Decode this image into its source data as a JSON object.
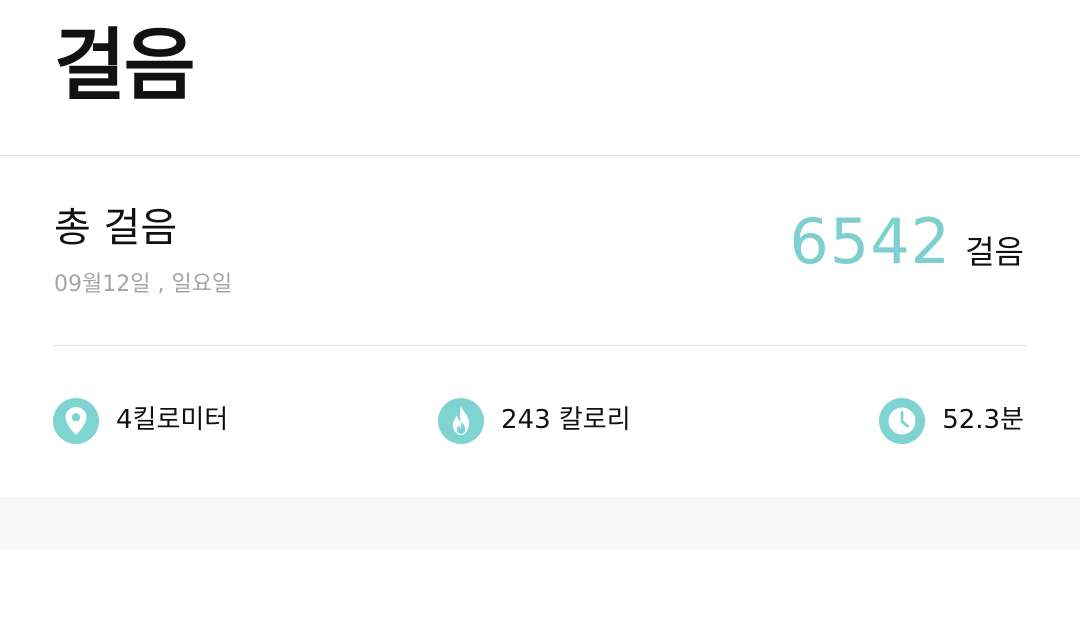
{
  "header": {
    "title": "걸음"
  },
  "summary": {
    "label": "총 걸음",
    "date": "09월12일 , 일요일",
    "steps": "6542",
    "steps_unit": "걸음"
  },
  "stats": {
    "distance": {
      "icon": "location-pin-icon",
      "text": "4킬로미터"
    },
    "calories": {
      "icon": "flame-icon",
      "text": "243 칼로리"
    },
    "duration": {
      "icon": "clock-icon",
      "text": "52.3분"
    }
  },
  "colors": {
    "accent": "#7ecfcf",
    "icon_bg": "#7fd3d0",
    "divider": "#dddddd",
    "secondary_text": "#a5a5a5",
    "bottom_band": "#f7f7f7"
  }
}
